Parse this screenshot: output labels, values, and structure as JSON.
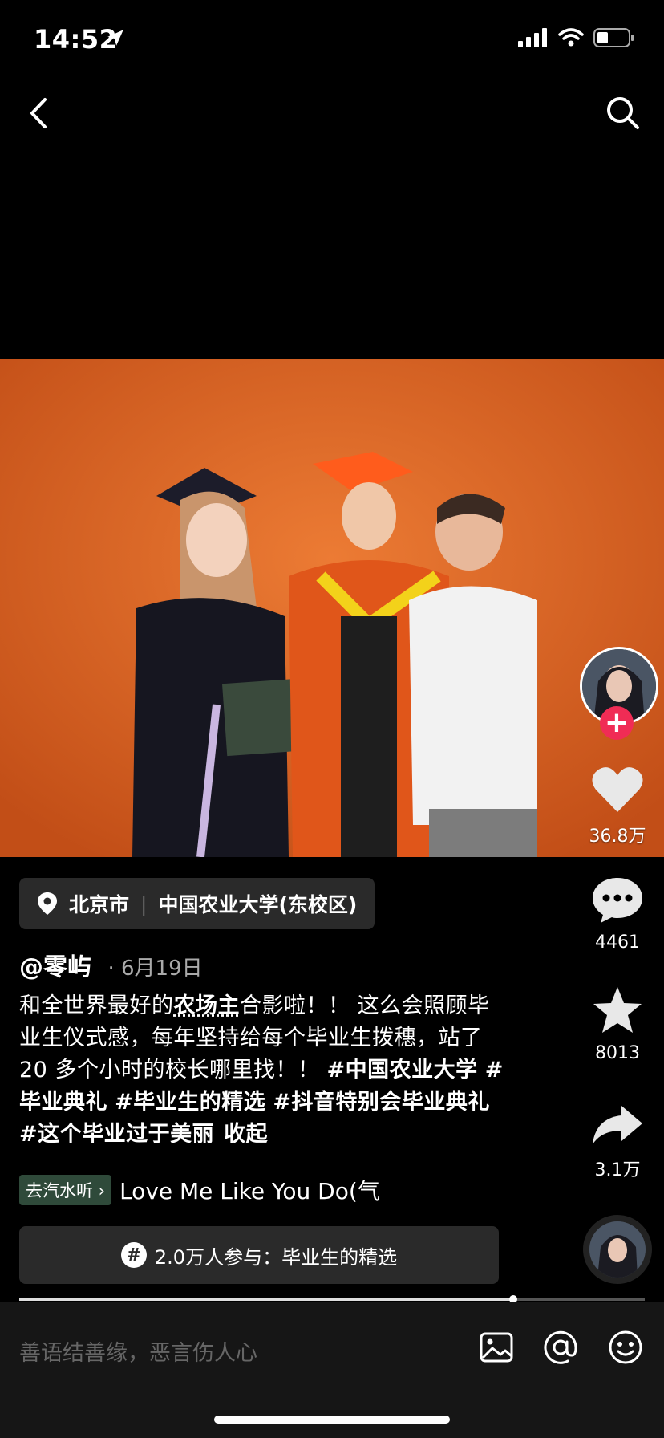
{
  "status": {
    "time": "14:52"
  },
  "video": {
    "bg_color": "#d45a1e"
  },
  "rail": {
    "likes": "36.8万",
    "comments": "4461",
    "favorites": "8013",
    "shares": "3.1万",
    "follow_symbol": "+"
  },
  "location": {
    "city": "北京市",
    "place": "中国农业大学(东校区)"
  },
  "author": {
    "handle": "@零屿",
    "separator": "·",
    "date": "6月19日"
  },
  "caption": {
    "part1": "和全世界最好的",
    "keyword": "农场主",
    "part2": "合影啦！！ 这么会照顾毕业生仪式感，每年坚持给每个毕业生拨穗，站了 20 多个小时的校长哪里找！！ ",
    "tags": [
      "#中国农业大学",
      "#毕业典礼",
      "#毕业生的精选",
      "#抖音特别会毕业典礼",
      "#这个毕业过于美丽"
    ],
    "collapse": "收起"
  },
  "music": {
    "chip": "去汽水听 ›",
    "title": "Love Me Like You Do(气"
  },
  "topic": {
    "icon": "#",
    "text": "2.0万人参与：毕业生的精选"
  },
  "progress": {
    "fraction": 0.79
  },
  "comment_bar": {
    "placeholder": "善语结善缘，恶言伤人心"
  }
}
